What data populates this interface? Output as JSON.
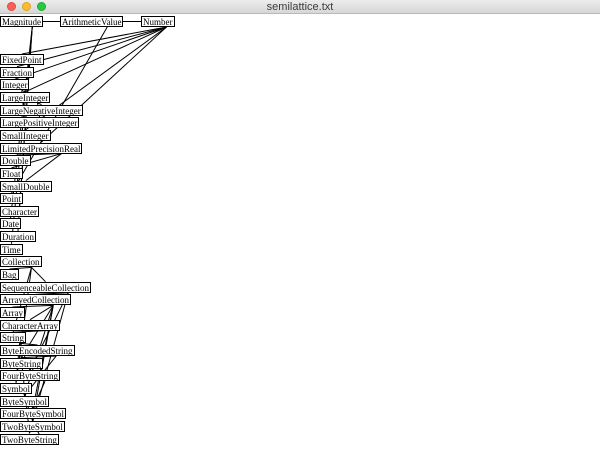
{
  "window": {
    "title": "semilattice.txt",
    "buttons": [
      "close",
      "minimize",
      "zoom"
    ]
  },
  "nodes": [
    {
      "id": "Magnitude",
      "label": "Magnitude"
    },
    {
      "id": "ArithmeticValue",
      "label": "ArithmeticValue"
    },
    {
      "id": "Number",
      "label": "Number"
    },
    {
      "id": "FixedPoint",
      "label": "FixedPoint"
    },
    {
      "id": "Fraction",
      "label": "Fraction"
    },
    {
      "id": "Integer",
      "label": "Integer"
    },
    {
      "id": "LargeInteger",
      "label": "LargeInteger"
    },
    {
      "id": "LargeNegativeInteger",
      "label": "LargeNegativeInteger"
    },
    {
      "id": "LargePositiveInteger",
      "label": "LargePositiveInteger"
    },
    {
      "id": "SmallInteger",
      "label": "SmallInteger"
    },
    {
      "id": "LimitedPrecisionReal",
      "label": "LimitedPrecisionReal"
    },
    {
      "id": "Double",
      "label": "Double"
    },
    {
      "id": "Float",
      "label": "Float"
    },
    {
      "id": "SmallDouble",
      "label": "SmallDouble"
    },
    {
      "id": "Point",
      "label": "Point"
    },
    {
      "id": "Character",
      "label": "Character"
    },
    {
      "id": "Date",
      "label": "Date"
    },
    {
      "id": "Duration",
      "label": "Duration"
    },
    {
      "id": "Time",
      "label": "Time"
    },
    {
      "id": "Collection",
      "label": "Collection"
    },
    {
      "id": "Bag",
      "label": "Bag"
    },
    {
      "id": "SequenceableCollection",
      "label": "SequenceableCollection"
    },
    {
      "id": "ArrayedCollection",
      "label": "ArrayedCollection"
    },
    {
      "id": "Array",
      "label": "Array"
    },
    {
      "id": "CharacterArray",
      "label": "CharacterArray"
    },
    {
      "id": "String",
      "label": "String"
    },
    {
      "id": "ByteEncodedString",
      "label": "ByteEncodedString"
    },
    {
      "id": "ByteString",
      "label": "ByteString"
    },
    {
      "id": "FourByteString",
      "label": "FourByteString"
    },
    {
      "id": "Symbol",
      "label": "Symbol"
    },
    {
      "id": "ByteSymbol",
      "label": "ByteSymbol"
    },
    {
      "id": "FourByteSymbol",
      "label": "FourByteSymbol"
    },
    {
      "id": "TwoByteSymbol",
      "label": "TwoByteSymbol"
    },
    {
      "id": "TwoByteString",
      "label": "TwoByteString"
    }
  ],
  "edges": [
    [
      "Magnitude",
      "ArithmeticValue"
    ],
    [
      "ArithmeticValue",
      "Number"
    ],
    [
      "Magnitude",
      "Character"
    ],
    [
      "Magnitude",
      "Date"
    ],
    [
      "Magnitude",
      "Duration"
    ],
    [
      "Magnitude",
      "Time"
    ],
    [
      "ArithmeticValue",
      "Point"
    ],
    [
      "Number",
      "FixedPoint"
    ],
    [
      "Number",
      "Fraction"
    ],
    [
      "Number",
      "Integer"
    ],
    [
      "Number",
      "LimitedPrecisionReal"
    ],
    [
      "Number",
      "LargeInteger"
    ],
    [
      "Number",
      "SmallInteger"
    ],
    [
      "Integer",
      "LargeInteger"
    ],
    [
      "Integer",
      "SmallInteger"
    ],
    [
      "LargeInteger",
      "LargeNegativeInteger"
    ],
    [
      "LargeInteger",
      "LargePositiveInteger"
    ],
    [
      "LimitedPrecisionReal",
      "Double"
    ],
    [
      "LimitedPrecisionReal",
      "Float"
    ],
    [
      "LimitedPrecisionReal",
      "SmallDouble"
    ],
    [
      "Collection",
      "Bag"
    ],
    [
      "Collection",
      "SequenceableCollection"
    ],
    [
      "SequenceableCollection",
      "ArrayedCollection"
    ],
    [
      "ArrayedCollection",
      "Array"
    ],
    [
      "ArrayedCollection",
      "CharacterArray"
    ],
    [
      "CharacterArray",
      "String"
    ],
    [
      "String",
      "ByteEncodedString"
    ],
    [
      "String",
      "FourByteString"
    ],
    [
      "String",
      "Symbol"
    ],
    [
      "String",
      "TwoByteString"
    ],
    [
      "ByteEncodedString",
      "ByteString"
    ],
    [
      "ByteEncodedString",
      "ByteSymbol"
    ],
    [
      "Symbol",
      "ByteSymbol"
    ],
    [
      "Symbol",
      "FourByteSymbol"
    ],
    [
      "Symbol",
      "TwoByteSymbol"
    ],
    [
      "FourByteString",
      "FourByteSymbol"
    ],
    [
      "TwoByteString",
      "TwoByteSymbol"
    ],
    [
      "ArrayedCollection",
      "ByteString"
    ],
    [
      "ArrayedCollection",
      "ByteSymbol"
    ],
    [
      "SequenceableCollection",
      "FourByteString"
    ],
    [
      "SequenceableCollection",
      "TwoByteString"
    ],
    [
      "Collection",
      "String"
    ],
    [
      "Collection",
      "Symbol"
    ],
    [
      "ArrayedCollection",
      "FourByteSymbol"
    ],
    [
      "ArrayedCollection",
      "TwoByteSymbol"
    ]
  ]
}
